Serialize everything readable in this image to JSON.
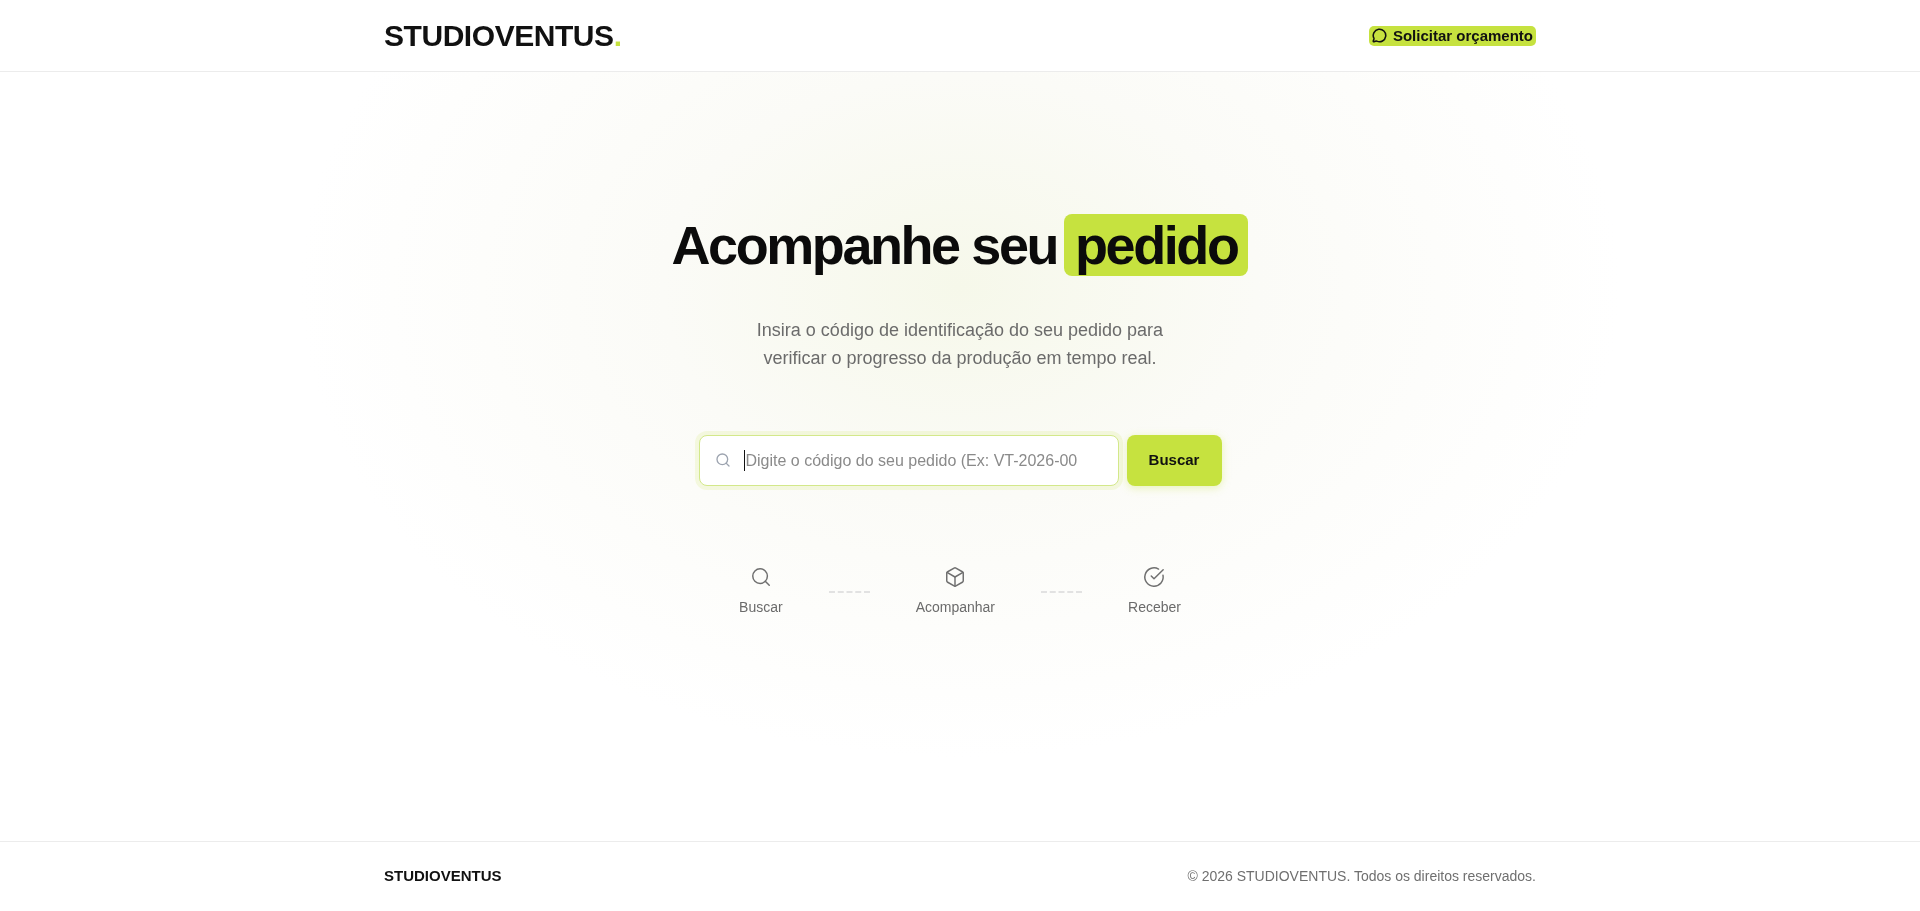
{
  "header": {
    "logo": {
      "text": "STUDIOVENTUS",
      "mark": "."
    },
    "cta_button": {
      "label": "Solicitar orçamento"
    }
  },
  "hero": {
    "title": "Acompanhe seu",
    "highlight": "pedido",
    "subtitle": "Insira o código de identificação do seu pedido para verificar o progresso da produção em tempo real."
  },
  "search": {
    "placeholder": "Digite o código do seu pedido (Ex: VT-2026-00",
    "focused": true,
    "button": "Buscar"
  },
  "steps": [
    {
      "label": "Buscar"
    },
    {
      "label": "Acompanhar"
    },
    {
      "label": "Receber"
    }
  ],
  "footer": {
    "brand": "STUDIOVENTUS",
    "copyright": "© 2026 STUDIOVENTUS. Todos os direitos reservados."
  }
}
